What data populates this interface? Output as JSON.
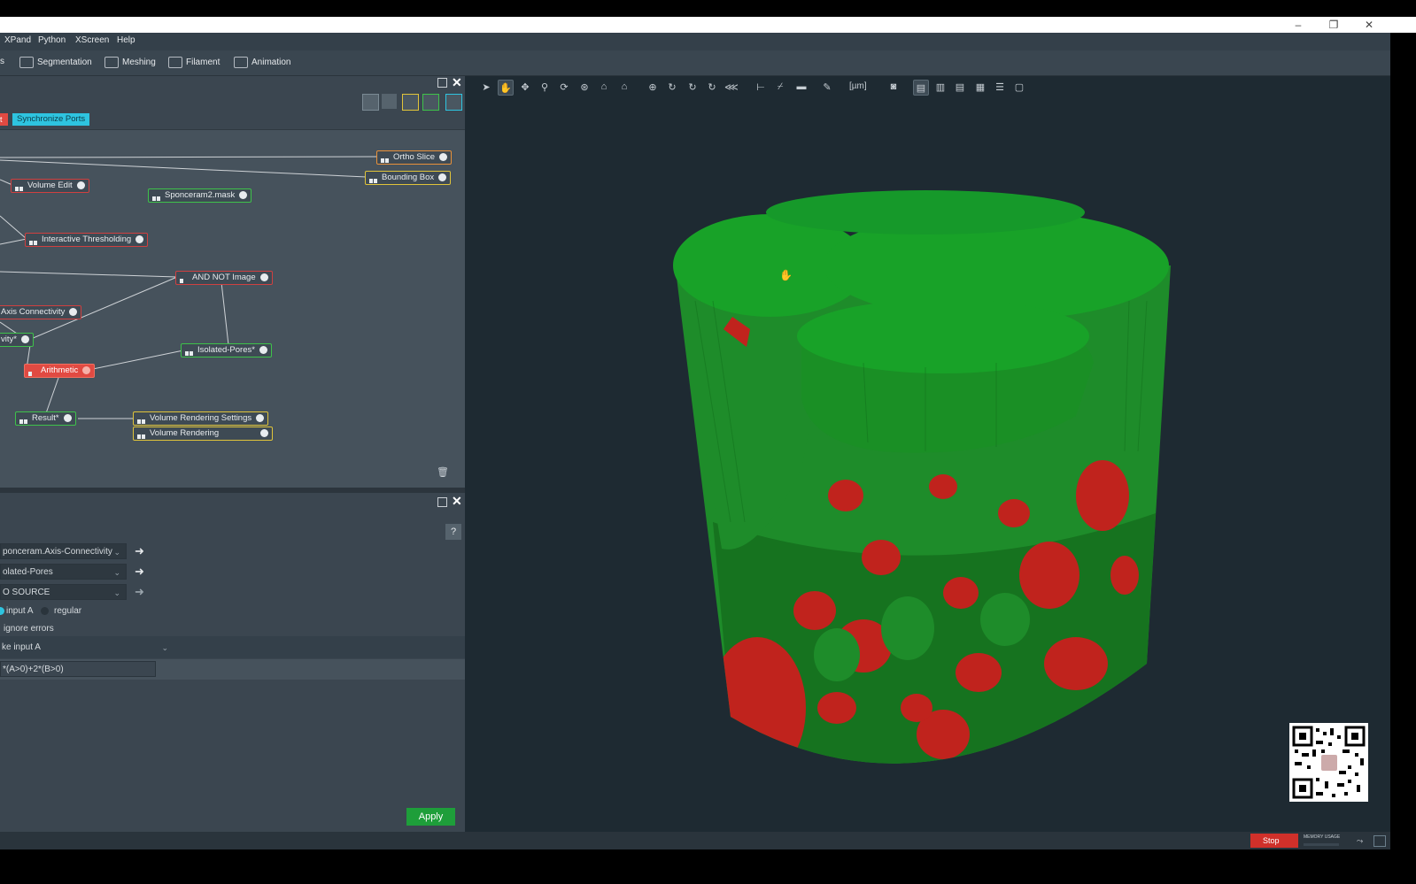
{
  "menu": [
    "XPand",
    "Python",
    "XScreen",
    "Help"
  ],
  "ribbon": {
    "stub": "s",
    "items": [
      {
        "label": "Segmentation",
        "icon": "layers-icon"
      },
      {
        "label": "Meshing",
        "icon": "mesh-icon"
      },
      {
        "label": "Filament",
        "icon": "filament-icon"
      },
      {
        "label": "Animation",
        "icon": "film-icon"
      }
    ]
  },
  "window_controls": {
    "minimize": "–",
    "restore": "❐",
    "close": "✕"
  },
  "project": {
    "red_tab_label": "t",
    "sync_ports_label": "Synchronize Ports",
    "nodes": {
      "ortho_slice": "Ortho Slice",
      "bounding_box": "Bounding Box",
      "volume_edit": "Volume Edit",
      "sponceram2_mask": "Sponceram2.mask",
      "interactive_thresholding": "Interactive Thresholding",
      "and_not_image": "AND NOT Image",
      "axis_connectivity": "Axis Connectivity",
      "connectivity": "vity*",
      "isolated_pores": "Isolated-Pores*",
      "arithmetic": "Arithmetic",
      "result": "Result*",
      "volume_rendering_settings": "Volume Rendering Settings",
      "volume_rendering": "Volume Rendering"
    }
  },
  "properties": {
    "help": "?",
    "input_a": "ponceram.Axis-Connectivity",
    "input_b": "olated-Pores",
    "input_c": "O SOURCE",
    "result_channels_option1": "input A",
    "result_channels_option2": "regular",
    "ignore_errors": "ignore errors",
    "result_type": "ke input A",
    "expression": "*(A>0)+2*(B>0)",
    "apply_label": "Apply"
  },
  "viewer": {
    "unit": "[µm]"
  },
  "status": {
    "stop_label": "Stop",
    "memory_label": "MEMORY USAGE"
  },
  "colors": {
    "solid_phase": "#1e8c2a",
    "pores": "#c0231d",
    "viewer_bg": "#1e2a32",
    "accent_sync": "#2ec4e0",
    "apply_green": "#1e9e3a"
  }
}
